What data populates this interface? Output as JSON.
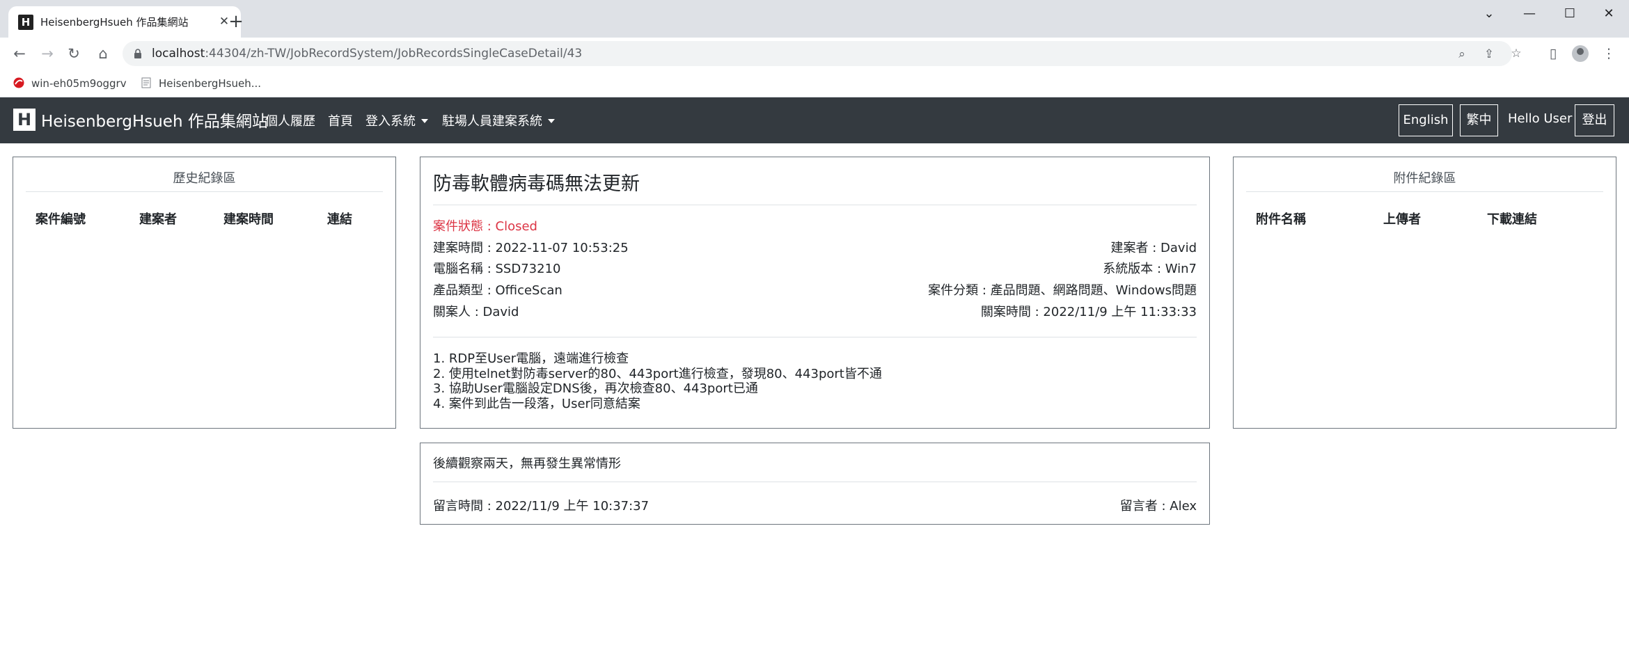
{
  "browser": {
    "tab_title": "HeisenbergHsueh 作品集網站",
    "favicon_letter": "H",
    "url_host": "localhost",
    "url_rest": ":44304/zh-TW/JobRecordSystem/JobRecordsSingleCaseDetail/43",
    "bookmarks": [
      "win-eh05m9oggrv",
      "HeisenbergHsueh..."
    ]
  },
  "navbar": {
    "brand_letter": "H",
    "brand": "HeisenbergHsueh 作品集網站",
    "links": [
      "個人履歷",
      "首頁",
      "登入系統",
      "駐場人員建案系統"
    ],
    "lang_en": "English",
    "lang_zh": "繁中",
    "hello": "Hello User",
    "logout": "登出",
    "bg_color": "#343a40"
  },
  "history": {
    "title": "歷史紀錄區",
    "columns": [
      "案件編號",
      "建案者",
      "建案時間",
      "連結"
    ]
  },
  "attachments": {
    "title": "附件紀錄區",
    "columns": [
      "附件名稱",
      "上傳者",
      "下載連結"
    ]
  },
  "case": {
    "title": "防毒軟體病毒碼無法更新",
    "status": "案件狀態 : Closed",
    "created": "建案時間 : 2022-11-07 10:53:25",
    "creator": "建案者 : David",
    "computer": "電腦名稱 : SSD73210",
    "os": "系統版本 : Win7",
    "product": "產品類型 : OfficeScan",
    "category": "案件分類 : 產品問題、網路問題、Windows問題",
    "closer": "關案人 : David",
    "closed_time": "關案時間 : 2022/11/9 上午 11:33:33",
    "steps": [
      "1. RDP至User電腦，遠端進行檢查",
      "2. 使用telnet對防毒server的80、443port進行檢查，發現80、443port皆不通",
      "3. 協助User電腦設定DNS後，再次檢查80、443port已通",
      "4. 案件到此告一段落，User同意結案"
    ],
    "status_color": "#dc3545"
  },
  "comment": {
    "text": "後續觀察兩天，無再發生異常情形",
    "time": "留言時間 : 2022/11/9 上午 10:37:37",
    "author": "留言者 : Alex"
  }
}
